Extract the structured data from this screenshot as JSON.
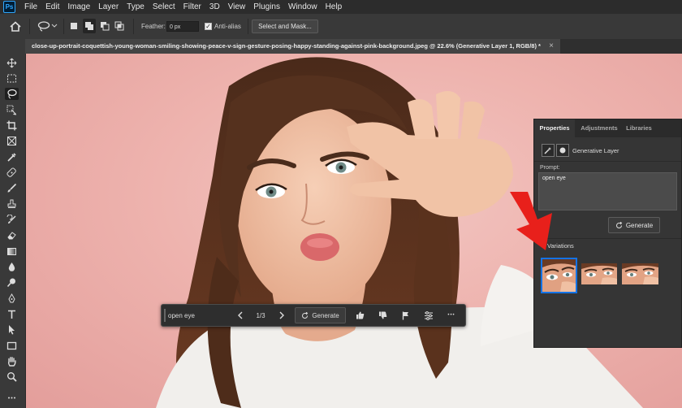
{
  "app": {
    "logo_text": "Ps"
  },
  "menu": [
    "File",
    "Edit",
    "Image",
    "Layer",
    "Type",
    "Select",
    "Filter",
    "3D",
    "View",
    "Plugins",
    "Window",
    "Help"
  ],
  "options_bar": {
    "feather_label": "Feather:",
    "feather_value": "0 px",
    "antialias_label": "Anti-alias",
    "antialias_checked": true,
    "select_mask_label": "Select and Mask..."
  },
  "document_tab": {
    "title": "close-up-portrait-coquettish-young-woman-smiling-showing-peace-v-sign-gesture-posing-happy-standing-against-pink-background.jpeg @ 22.6% (Generative Layer 1, RGB/8) *",
    "close_glyph": "×"
  },
  "toolbar": {
    "tools": [
      "move-tool",
      "marquee-tool",
      "lasso-tool",
      "object-select-tool",
      "crop-tool",
      "frame-tool",
      "eyedropper-tool",
      "spot-healing-tool",
      "brush-tool",
      "clone-stamp-tool",
      "history-brush-tool",
      "eraser-tool",
      "gradient-tool",
      "blur-tool",
      "dodge-tool",
      "pen-tool",
      "type-tool",
      "path-select-tool",
      "rectangle-tool",
      "hand-tool",
      "zoom-tool"
    ],
    "active_tool": "lasso-tool"
  },
  "taskbar": {
    "prompt_value": "open eye",
    "counter": "1/3",
    "generate_label": "Generate",
    "more_glyph": "•••"
  },
  "properties_panel": {
    "tabs": [
      "Properties",
      "Adjustments",
      "Libraries"
    ],
    "active_tab": "Properties",
    "layer_type_label": "Generative Layer",
    "prompt_label": "Prompt:",
    "prompt_value": "open eye",
    "generate_label": "Generate",
    "variations_label": "Variations",
    "selected_variation": 1,
    "variation_count": 3
  },
  "colors": {
    "accent": "#1473e6",
    "arrow": "#e8201b",
    "canvas_bg": "#eeb3ae"
  }
}
